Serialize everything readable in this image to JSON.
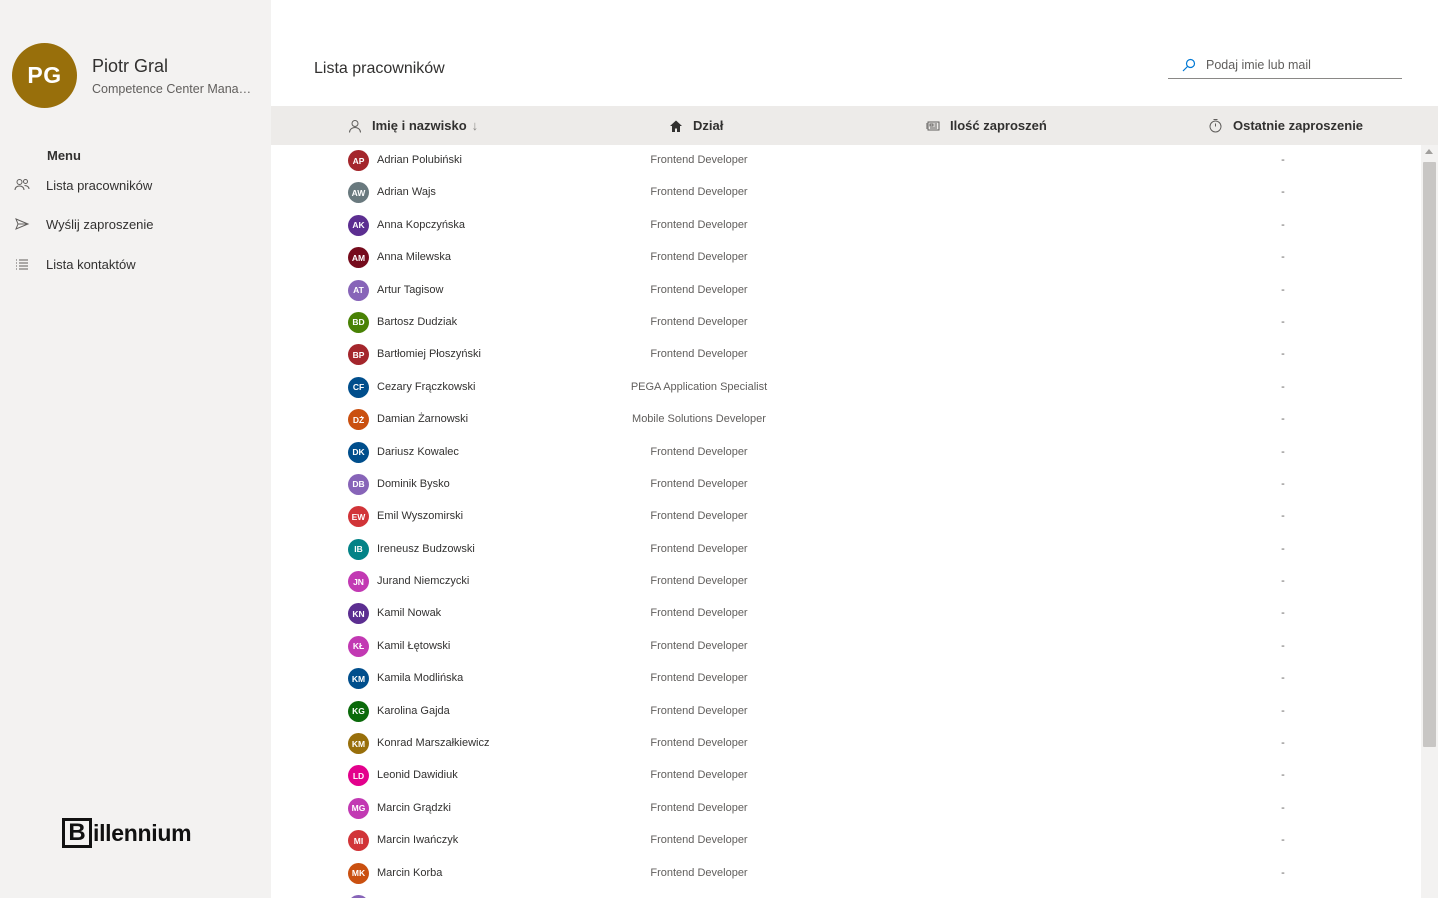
{
  "user": {
    "initials": "PG",
    "name": "Piotr Gral",
    "role": "Competence Center Manager",
    "avatar_color": "#986f0b"
  },
  "sidebar": {
    "menu_heading": "Menu",
    "items": [
      {
        "label": "Lista pracowników",
        "icon": "people-icon"
      },
      {
        "label": "Wyślij zaproszenie",
        "icon": "send-icon"
      },
      {
        "label": "Lista kontaktów",
        "icon": "list-icon"
      }
    ],
    "logo_letter": "B",
    "logo_text": "illennium"
  },
  "main": {
    "title": "Lista pracowników",
    "search": {
      "placeholder": "Podaj imie lub mail",
      "value": ""
    },
    "columns": [
      {
        "label": "Imię i nazwisko",
        "icon": "contact-icon",
        "sort": "↓"
      },
      {
        "label": "Dział",
        "icon": "home-icon"
      },
      {
        "label": "Ilość zaproszeń",
        "icon": "news-icon"
      },
      {
        "label": "Ostatnie zaproszenie",
        "icon": "timer-icon"
      }
    ],
    "rows": [
      {
        "initials": "AP",
        "color": "#a4262c",
        "name": "Adrian Polubiński",
        "dept": "Frontend Developer",
        "last": "-"
      },
      {
        "initials": "AW",
        "color": "#69797e",
        "name": "Adrian Wajs",
        "dept": "Frontend Developer",
        "last": "-"
      },
      {
        "initials": "AK",
        "color": "#5c2e91",
        "name": "Anna Kopczyńska",
        "dept": "Frontend Developer",
        "last": "-"
      },
      {
        "initials": "AM",
        "color": "#750b1c",
        "name": "Anna Milewska",
        "dept": "Frontend Developer",
        "last": "-"
      },
      {
        "initials": "AT",
        "color": "#8764b8",
        "name": "Artur Tagisow",
        "dept": "Frontend Developer",
        "last": "-"
      },
      {
        "initials": "BD",
        "color": "#498205",
        "name": "Bartosz Dudziak",
        "dept": "Frontend Developer",
        "last": "-"
      },
      {
        "initials": "BP",
        "color": "#a4262c",
        "name": "Bartłomiej Płoszyński",
        "dept": "Frontend Developer",
        "last": "-"
      },
      {
        "initials": "CF",
        "color": "#004e8c",
        "name": "Cezary Frączkowski",
        "dept": "PEGA Application Specialist",
        "last": "-"
      },
      {
        "initials": "DŻ",
        "color": "#ca5010",
        "name": "Damian Żarnowski",
        "dept": "Mobile Solutions Developer",
        "last": "-"
      },
      {
        "initials": "DK",
        "color": "#004e8c",
        "name": "Dariusz Kowalec",
        "dept": "Frontend Developer",
        "last": "-"
      },
      {
        "initials": "DB",
        "color": "#8764b8",
        "name": "Dominik Bysko",
        "dept": "Frontend Developer",
        "last": "-"
      },
      {
        "initials": "EW",
        "color": "#d13438",
        "name": "Emil Wyszomirski",
        "dept": "Frontend Developer",
        "last": "-"
      },
      {
        "initials": "IB",
        "color": "#038387",
        "name": "Ireneusz Budzowski",
        "dept": "Frontend Developer",
        "last": "-"
      },
      {
        "initials": "JN",
        "color": "#c239b3",
        "name": "Jurand Niemczycki",
        "dept": "Frontend Developer",
        "last": "-"
      },
      {
        "initials": "KN",
        "color": "#5c2e91",
        "name": "Kamil Nowak",
        "dept": "Frontend Developer",
        "last": "-"
      },
      {
        "initials": "KŁ",
        "color": "#c239b3",
        "name": "Kamil Łętowski",
        "dept": "Frontend Developer",
        "last": "-"
      },
      {
        "initials": "KM",
        "color": "#004e8c",
        "name": "Kamila Modlińska",
        "dept": "Frontend Developer",
        "last": "-"
      },
      {
        "initials": "KG",
        "color": "#0b6a0b",
        "name": "Karolina Gajda",
        "dept": "Frontend Developer",
        "last": "-"
      },
      {
        "initials": "KM",
        "color": "#986f0b",
        "name": "Konrad Marszałkiewicz",
        "dept": "Frontend Developer",
        "last": "-"
      },
      {
        "initials": "LD",
        "color": "#e3008c",
        "name": "Leonid Dawidiuk",
        "dept": "Frontend Developer",
        "last": "-"
      },
      {
        "initials": "MG",
        "color": "#c239b3",
        "name": "Marcin Grądzki",
        "dept": "Frontend Developer",
        "last": "-"
      },
      {
        "initials": "MI",
        "color": "#d13438",
        "name": "Marcin Iwańczyk",
        "dept": "Frontend Developer",
        "last": "-"
      },
      {
        "initials": "MK",
        "color": "#ca5010",
        "name": "Marcin Korba",
        "dept": "Frontend Developer",
        "last": "-"
      },
      {
        "initials": "",
        "color": "#8764b8",
        "name": "",
        "dept": "",
        "last": ""
      }
    ]
  }
}
